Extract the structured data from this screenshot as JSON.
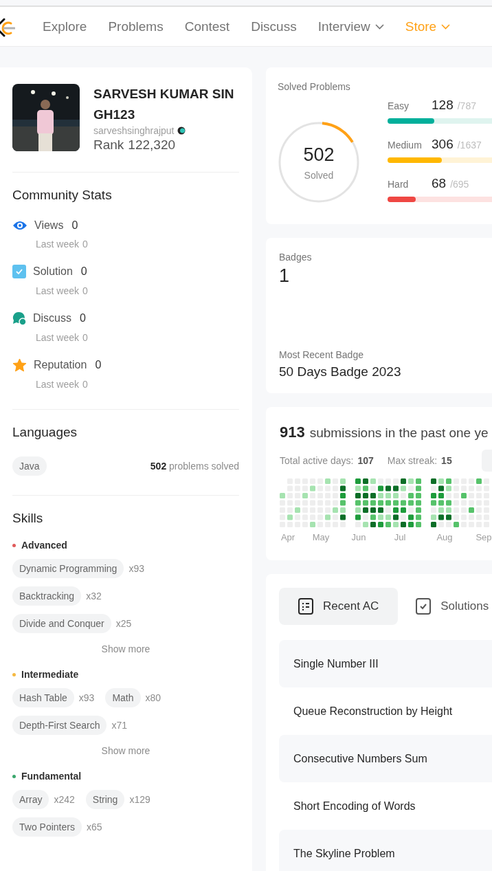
{
  "nav": {
    "items": [
      {
        "label": "Explore",
        "dropdown": false,
        "color": "#757575"
      },
      {
        "label": "Problems",
        "dropdown": false,
        "color": "#757575"
      },
      {
        "label": "Contest",
        "dropdown": false,
        "color": "#757575"
      },
      {
        "label": "Discuss",
        "dropdown": false,
        "color": "#757575"
      },
      {
        "label": "Interview",
        "dropdown": true,
        "color": "#757575"
      },
      {
        "label": "Store",
        "dropdown": true,
        "color": "#ffa116"
      }
    ]
  },
  "profile": {
    "name": "SARVESH KUMAR SINGH123",
    "username": "sarveshsinghrajput",
    "rank_label": "Rank",
    "rank": "122,320"
  },
  "community_stats": {
    "title": "Community Stats",
    "items": [
      {
        "kind": "views",
        "label": "Views",
        "value": "0",
        "sub_label": "Last week",
        "sub_value": "0"
      },
      {
        "kind": "solution",
        "label": "Solution",
        "value": "0",
        "sub_label": "Last week",
        "sub_value": "0"
      },
      {
        "kind": "discuss",
        "label": "Discuss",
        "value": "0",
        "sub_label": "Last week",
        "sub_value": "0"
      },
      {
        "kind": "reputation",
        "label": "Reputation",
        "value": "0",
        "sub_label": "Last week",
        "sub_value": "0"
      }
    ]
  },
  "languages": {
    "title": "Languages",
    "items": [
      {
        "name": "Java",
        "count": "502",
        "suffix": "problems solved"
      }
    ]
  },
  "skills": {
    "title": "Skills",
    "groups": [
      {
        "name": "Advanced",
        "color": "#e05a5a",
        "tags": [
          {
            "name": "Dynamic Programming",
            "count": "x93"
          },
          {
            "name": "Backtracking",
            "count": "x32"
          },
          {
            "name": "Divide and Conquer",
            "count": "x25"
          }
        ],
        "more": "Show more"
      },
      {
        "name": "Intermediate",
        "color": "#f5b942",
        "tags": [
          {
            "name": "Hash Table",
            "count": "x93"
          },
          {
            "name": "Math",
            "count": "x80"
          },
          {
            "name": "Depth-First Search",
            "count": "x71"
          }
        ],
        "more": "Show more"
      },
      {
        "name": "Fundamental",
        "color": "#3aa76d",
        "tags": [
          {
            "name": "Array",
            "count": "x242"
          },
          {
            "name": "String",
            "count": "x129"
          },
          {
            "name": "Two Pointers",
            "count": "x65"
          }
        ]
      }
    ]
  },
  "solved": {
    "title": "Solved Problems",
    "total": "502",
    "total_label": "Solved",
    "level": 0.15,
    "difficulties": [
      {
        "kind": "easy",
        "label": "Easy",
        "solved": "128",
        "total": "/787",
        "level": 0.45
      },
      {
        "kind": "medium",
        "label": "Medium",
        "solved": "306",
        "total": "/1637",
        "level": 0.52
      },
      {
        "kind": "hard",
        "label": "Hard",
        "solved": "68",
        "total": "/695",
        "level": 0.27
      }
    ]
  },
  "badges": {
    "title": "Badges",
    "count": "1",
    "recent_label": "Most Recent Badge",
    "recent": "50 Days Badge 2023"
  },
  "submissions": {
    "count": "913",
    "text": "submissions in the past one ye",
    "active_label": "Total active days:",
    "active": "107",
    "streak_label": "Max streak:",
    "streak": "15",
    "months": [
      "Apr",
      "May",
      "Jun",
      "Jul",
      "Aug",
      "Sep"
    ]
  },
  "recent": {
    "tabs": [
      {
        "label": "Recent AC",
        "kind": "list",
        "selected": true
      },
      {
        "label": "Solutions",
        "kind": "check",
        "selected": false
      }
    ],
    "items": [
      "Single Number III",
      "Queue Reconstruction by Height",
      "Consecutive Numbers Sum",
      "Short Encoding of Words",
      "The Skyline Problem"
    ]
  }
}
